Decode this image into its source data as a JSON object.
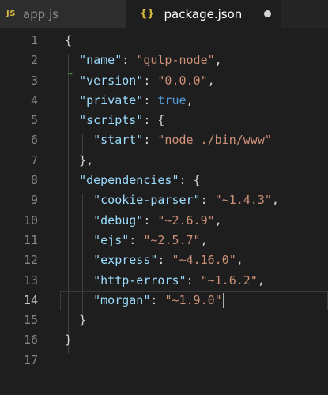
{
  "tabs": [
    {
      "label": "app.js",
      "icon": "JS",
      "active": false
    },
    {
      "label": "package.json",
      "icon": "{}",
      "active": true,
      "dirty": true
    }
  ],
  "editor": {
    "current_line": 14,
    "line_numbers": [
      "1",
      "2",
      "3",
      "4",
      "5",
      "6",
      "7",
      "8",
      "9",
      "10",
      "11",
      "12",
      "13",
      "14",
      "15",
      "16",
      "17"
    ],
    "lines": [
      "{",
      "  \"name\": \"gulp-node\",",
      "  \"version\": \"0.0.0\",",
      "  \"private\": true,",
      "  \"scripts\": {",
      "    \"start\": \"node ./bin/www\"",
      "  },",
      "  \"dependencies\": {",
      "    \"cookie-parser\": \"~1.4.3\",",
      "    \"debug\": \"~2.6.9\",",
      "    \"ejs\": \"~2.5.7\",",
      "    \"express\": \"~4.16.0\",",
      "    \"http-errors\": \"~1.6.2\",",
      "    \"morgan\": \"~1.9.0\"",
      "  }",
      "}",
      ""
    ]
  },
  "colors": {
    "key": "#9cdcfe",
    "string": "#ce9178",
    "boolean": "#569cd6",
    "punctuation": "#d4d4d4",
    "icon_accent": "#d7ba40"
  }
}
